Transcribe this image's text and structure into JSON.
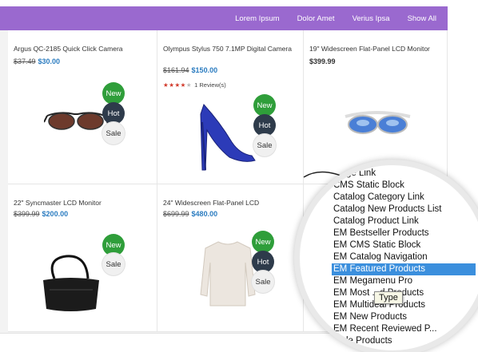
{
  "nav": [
    "Lorem Ipsum",
    "Dolor Amet",
    "Verius Ipsa",
    "Show All"
  ],
  "products": [
    {
      "title": "Argus QC-2185 Quick Click Camera",
      "old_price": "$37.49",
      "price": "$30.00",
      "badges": [
        "New",
        "Hot",
        "Sale"
      ]
    },
    {
      "title": "Olympus Stylus 750 7.1MP Digital Camera",
      "old_price": "$161.94",
      "price": "$150.00",
      "rating_stars": 4,
      "rating_max": 5,
      "reviews": "1 Review(s)",
      "badges": [
        "New",
        "Hot",
        "Sale"
      ]
    },
    {
      "title": "19\" Widescreen Flat-Panel LCD Monitor",
      "price": "$399.99",
      "badges": []
    },
    {
      "title": "22\" Syncmaster LCD Monitor",
      "old_price": "$399.99",
      "price": "$200.00",
      "badges": [
        "New",
        "Sale"
      ]
    },
    {
      "title": "24\" Widescreen Flat-Panel LCD",
      "old_price": "$699.99",
      "price": "$480.00",
      "badges": [
        "New",
        "Hot",
        "Sale"
      ]
    }
  ],
  "dropdown": {
    "options": [
      "...age Link",
      "CMS Static Block",
      "Catalog Category Link",
      "Catalog New Products List",
      "Catalog Product Link",
      "EM Bestseller Products",
      "EM CMS Static Block",
      "EM Catalog Navigation",
      "EM Featured Products",
      "EM Megamenu Pro",
      "EM Most ...d Products",
      "EM Multideal Products",
      "EM New Products",
      "EM Recent Reviewed P...",
      "...ale Products"
    ],
    "selected_index": 8,
    "tooltip": "Type"
  },
  "colors": {
    "topbar": "#9a69cf",
    "new_badge": "#2f9e3a",
    "hot_badge": "#2e3b4b",
    "price": "#2b7cc0",
    "selected": "#3b8fdd"
  }
}
